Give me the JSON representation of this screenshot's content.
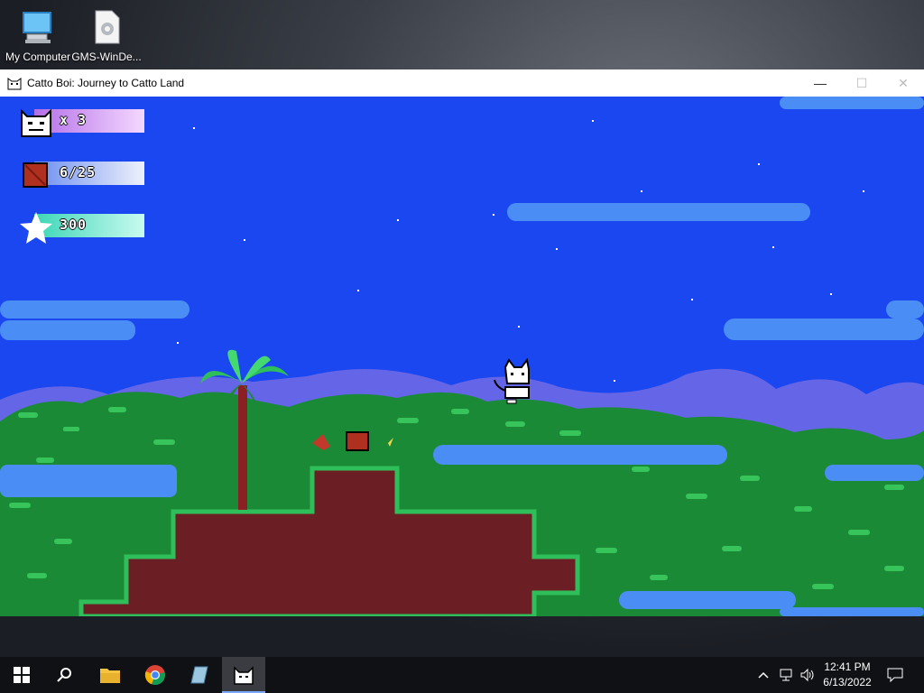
{
  "desktop": {
    "icons": [
      {
        "label": "My Computer",
        "icon": "computer-icon"
      },
      {
        "label": "GMS-WinDe...",
        "icon": "settings-file-icon"
      }
    ]
  },
  "window": {
    "title": "Catto Boi: Journey to Catto Land",
    "controls": {
      "minimize": "—",
      "maximize": "☐",
      "close": "✕"
    }
  },
  "hud": {
    "lives": "x 3",
    "crates": "6/25",
    "score": "300"
  },
  "taskbar": {
    "apps": [
      "start-icon",
      "search-icon",
      "file-explorer-icon",
      "chrome-icon",
      "gms-runner-icon",
      "catto-boi-icon"
    ],
    "clock_time": "12:41 PM",
    "clock_date": "6/13/2022"
  },
  "colors": {
    "sky": "#1b47f0",
    "cloud": "#4a8ef5",
    "dirt": "#6b1f24",
    "grass": "#2fbf5a",
    "hud_lives": "#d9a6f5",
    "hud_crates": "#cfd8f7",
    "hud_score": "#7af0d8"
  }
}
